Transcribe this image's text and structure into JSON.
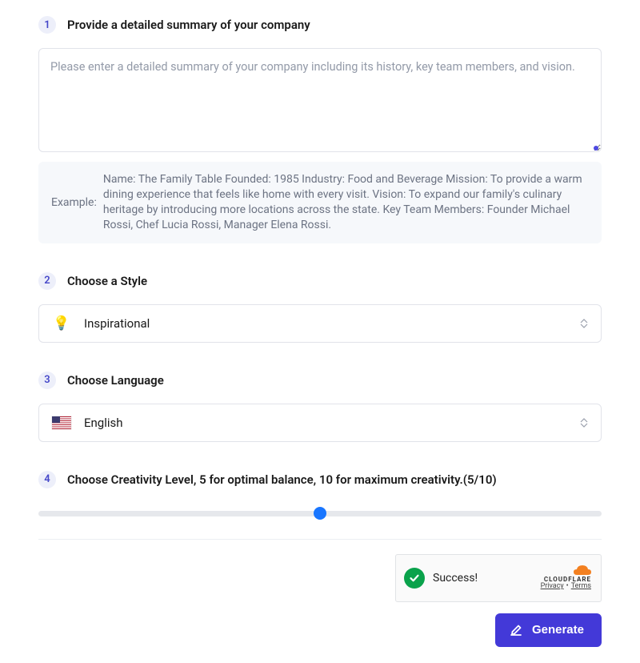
{
  "steps": {
    "s1": {
      "num": "1",
      "title": "Provide a detailed summary of your company",
      "placeholder": "Please enter a detailed summary of your company including its history, key team members, and vision.",
      "value": "",
      "example_label": "Example:",
      "example_body": "Name: The Family Table Founded: 1985 Industry: Food and Beverage Mission: To provide a warm dining experience that feels like home with every visit. Vision: To expand our family's culinary heritage by introducing more locations across the state. Key Team Members: Founder Michael Rossi, Chef Lucia Rossi, Manager Elena Rossi."
    },
    "s2": {
      "num": "2",
      "title": "Choose a Style",
      "icon": "💡",
      "value": "Inspirational"
    },
    "s3": {
      "num": "3",
      "title": "Choose Language",
      "value": "English"
    },
    "s4": {
      "num": "4",
      "title": "Choose Creativity Level, 5 for optimal balance, 10 for maximum creativity.(5/10)",
      "value": 5,
      "min": 0,
      "max": 10
    }
  },
  "captcha": {
    "status": "Success!",
    "brand": "CLOUDFLARE",
    "links": {
      "privacy": "Privacy",
      "terms": "Terms"
    }
  },
  "actions": {
    "generate": "Generate"
  },
  "colors": {
    "accent": "#4339d8",
    "slider_thumb": "#1976ff",
    "success": "#0aa24b",
    "cloudflare": "#f38020"
  }
}
